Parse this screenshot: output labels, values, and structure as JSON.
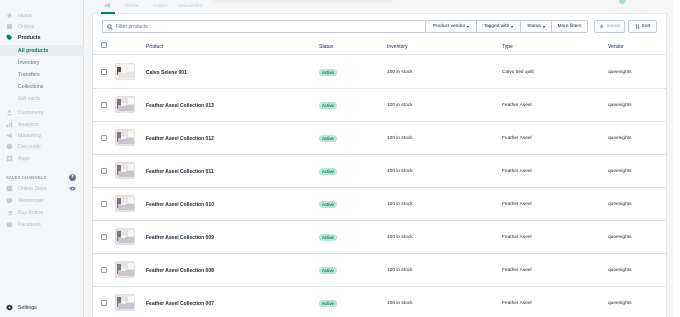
{
  "sidebar": {
    "items": [
      {
        "label": "Home",
        "icon": "home-icon"
      },
      {
        "label": "Orders",
        "icon": "orders-icon"
      },
      {
        "label": "Products",
        "icon": "tag-icon"
      },
      {
        "label": "All products"
      },
      {
        "label": "Inventory"
      },
      {
        "label": "Transfers"
      },
      {
        "label": "Collections"
      },
      {
        "label": "Gift cards"
      },
      {
        "label": "Customers",
        "icon": "customers-icon"
      },
      {
        "label": "Analytics",
        "icon": "analytics-icon"
      },
      {
        "label": "Marketing",
        "icon": "marketing-icon"
      },
      {
        "label": "Discounts",
        "icon": "discounts-icon"
      },
      {
        "label": "Apps",
        "icon": "apps-icon"
      }
    ],
    "sales_channels_heading": "SALES CHANNELS",
    "channels": [
      {
        "label": "Online Store",
        "icon": "store-icon"
      },
      {
        "label": "Messenger",
        "icon": "messenger-icon"
      },
      {
        "label": "Buy Button",
        "icon": "buy-button-icon"
      },
      {
        "label": "Facebook",
        "icon": "facebook-icon"
      }
    ],
    "settings_label": "Settings"
  },
  "tabs": [
    "All",
    "Visible",
    "Hidden",
    "Unavailable"
  ],
  "filters": {
    "search_placeholder": "Filter products",
    "vendor_label": "Product vendor",
    "tagged_label": "Tagged with",
    "status_label": "Status",
    "more_label": "More filters",
    "saved_label": "Saved",
    "sort_label": "Sort"
  },
  "table": {
    "headers": {
      "product": "Product",
      "status": "Status",
      "inventory": "Inventory",
      "type": "Type",
      "vendor": "Vendor"
    },
    "rows": [
      {
        "name": "Calvo Selene 001",
        "status": "Active",
        "inventory": "100 in stock",
        "type": "Calvo bed quilt",
        "vendor": "queenights"
      },
      {
        "name": "Feather Aseel Collection 013",
        "status": "Active",
        "inventory": "100 in stock",
        "type": "Feather Aseel",
        "vendor": "queenights"
      },
      {
        "name": "Feather Aseel Collection 012",
        "status": "Active",
        "inventory": "100 in stock",
        "type": "Feather Aseel",
        "vendor": "queenights"
      },
      {
        "name": "Feather Aseel Collection 011",
        "status": "Active",
        "inventory": "100 in stock",
        "type": "Feather Aseel",
        "vendor": "queenights"
      },
      {
        "name": "Feather Aseel Collection 010",
        "status": "Active",
        "inventory": "100 in stock",
        "type": "Feather Aseel",
        "vendor": "queenights"
      },
      {
        "name": "Feather Aseel Collection 009",
        "status": "Active",
        "inventory": "100 in stock",
        "type": "Feather Aseel",
        "vendor": "queenights"
      },
      {
        "name": "Feather Aseel Collection 008",
        "status": "Active",
        "inventory": "100 in stock",
        "type": "Feather Aseel",
        "vendor": "queenights"
      },
      {
        "name": "Feather Aseel Collection 007",
        "status": "Active",
        "inventory": "100 in stock",
        "type": "Feather Aseel",
        "vendor": "queenights"
      }
    ]
  },
  "colors": {
    "accent": "#008060",
    "badge_bg": "#aee9d1",
    "border": "#dfe3e8"
  }
}
